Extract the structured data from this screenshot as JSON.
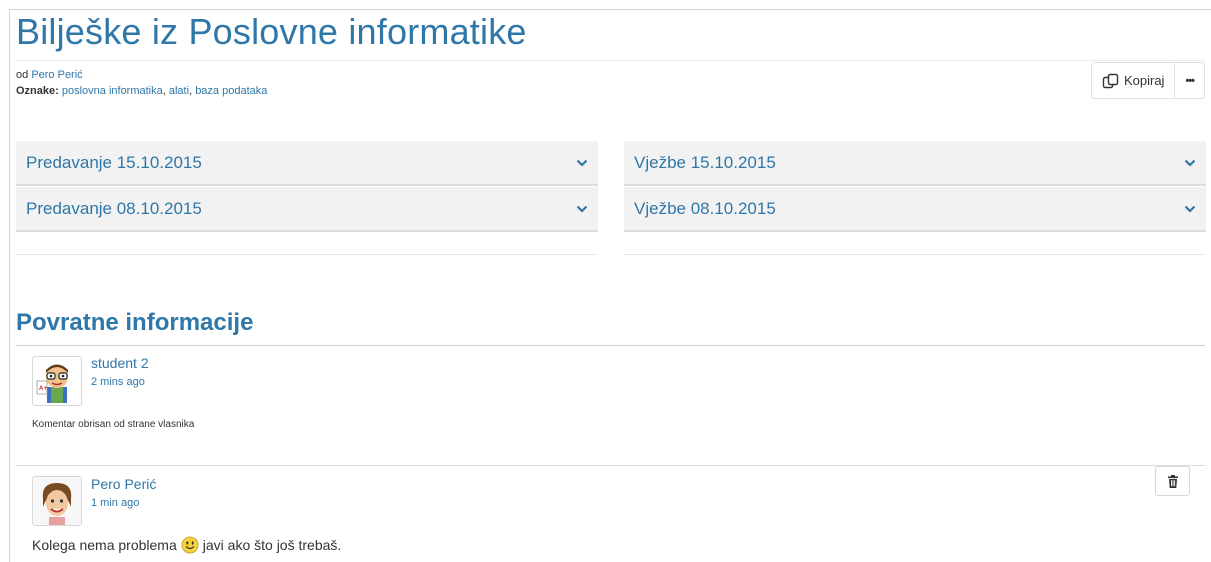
{
  "page": {
    "title": "Bilješke iz Poslovne informatike",
    "by_prefix": "od",
    "author": "Pero Perić",
    "tags_label": "Oznake:",
    "tags": [
      "poslovna informatika",
      "alati",
      "baza podataka"
    ]
  },
  "toolbar": {
    "copy_label": "Kopiraj",
    "more_label": "•••"
  },
  "accordion": {
    "left": [
      {
        "label": "Predavanje 15.10.2015"
      },
      {
        "label": "Predavanje 08.10.2015"
      }
    ],
    "right": [
      {
        "label": "Vježbe 15.10.2015"
      },
      {
        "label": "Vježbe 08.10.2015"
      }
    ]
  },
  "feedback": {
    "title": "Povratne informacije",
    "comments": [
      {
        "author": "student 2",
        "time": "2 mins ago",
        "text": "Komentar obrisan od strane vlasnika"
      },
      {
        "author": "Pero Perić",
        "time": "1 min ago",
        "text_before": "Kolega nema problema",
        "text_after": "javi ako što još trebaš."
      }
    ]
  },
  "colors": {
    "accent": "#2f77a8",
    "accordion_bg": "#f2f2f2"
  }
}
